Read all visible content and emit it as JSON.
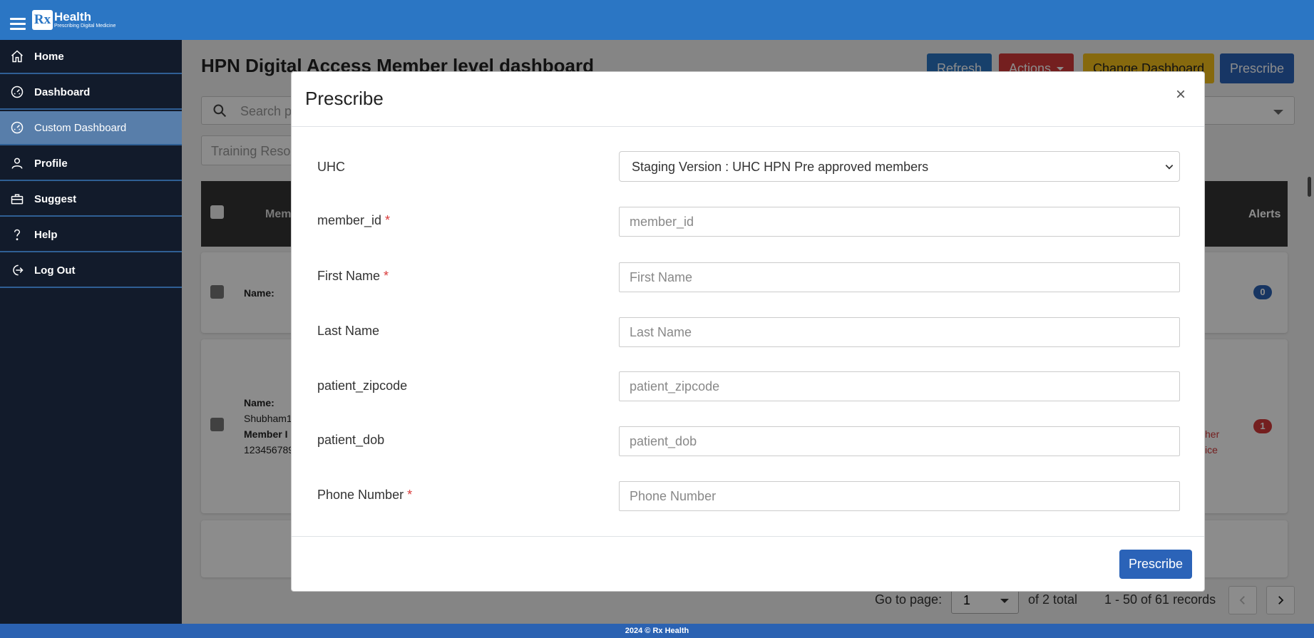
{
  "app": {
    "logo_mark": "Rx",
    "logo_title": "Health",
    "logo_subtitle": "Prescribing Digital Medicine"
  },
  "sidebar": {
    "items": [
      {
        "label": "Home",
        "icon": "home-icon"
      },
      {
        "label": "Dashboard",
        "icon": "gauge-icon"
      },
      {
        "label": "Custom Dashboard",
        "icon": "gauge-icon",
        "active": true
      },
      {
        "label": "Profile",
        "icon": "user-icon"
      },
      {
        "label": "Suggest",
        "icon": "briefcase-icon"
      },
      {
        "label": "Help",
        "icon": "question-icon"
      },
      {
        "label": "Log Out",
        "icon": "logout-icon"
      }
    ]
  },
  "page": {
    "title": "HPN Digital Access Member level dashboard",
    "buttons": {
      "refresh": "Refresh",
      "actions": "Actions",
      "change_dashboard": "Change Dashboard",
      "prescribe": "Prescribe"
    },
    "search_placeholder": "Search p",
    "training": "Training Reso",
    "table": {
      "member_header": "Memb",
      "alerts_header": "Alerts"
    },
    "rows": [
      {
        "name_label": "Name:",
        "alerts": "0"
      },
      {
        "name_label": "Name:",
        "name_value": "Shubham1",
        "member_label": "Member I",
        "member_value": "123456789",
        "note_1": "her",
        "note_2": "ice",
        "alerts": "1"
      }
    ],
    "pager": {
      "goto_label": "Go to page:",
      "page_value": "1",
      "of_total": "of 2 total",
      "records": "1 - 50 of 61 records"
    }
  },
  "footer": {
    "text": "2024 © Rx Health"
  },
  "modal": {
    "title": "Prescribe",
    "close": "×",
    "fields": {
      "uhc": {
        "label": "UHC",
        "value": "Staging Version : UHC HPN Pre approved members"
      },
      "member_id": {
        "label": "member_id",
        "placeholder": "member_id",
        "required": "*"
      },
      "first_name": {
        "label": "First Name",
        "placeholder": "First Name",
        "required": "*"
      },
      "last_name": {
        "label": "Last Name",
        "placeholder": "Last Name"
      },
      "zipcode": {
        "label": "patient_zipcode",
        "placeholder": "patient_zipcode"
      },
      "dob": {
        "label": "patient_dob",
        "placeholder": "patient_dob"
      },
      "phone": {
        "label": "Phone Number",
        "placeholder": "Phone Number",
        "required": "*"
      }
    },
    "submit": "Prescribe"
  },
  "colors": {
    "topbar": "#2b76c4",
    "sidebar": "#121b2b",
    "sidebar_active": "#587eaa",
    "primary_button": "#2b63b8",
    "danger": "#d43a3a",
    "warning": "#f5c01a"
  }
}
